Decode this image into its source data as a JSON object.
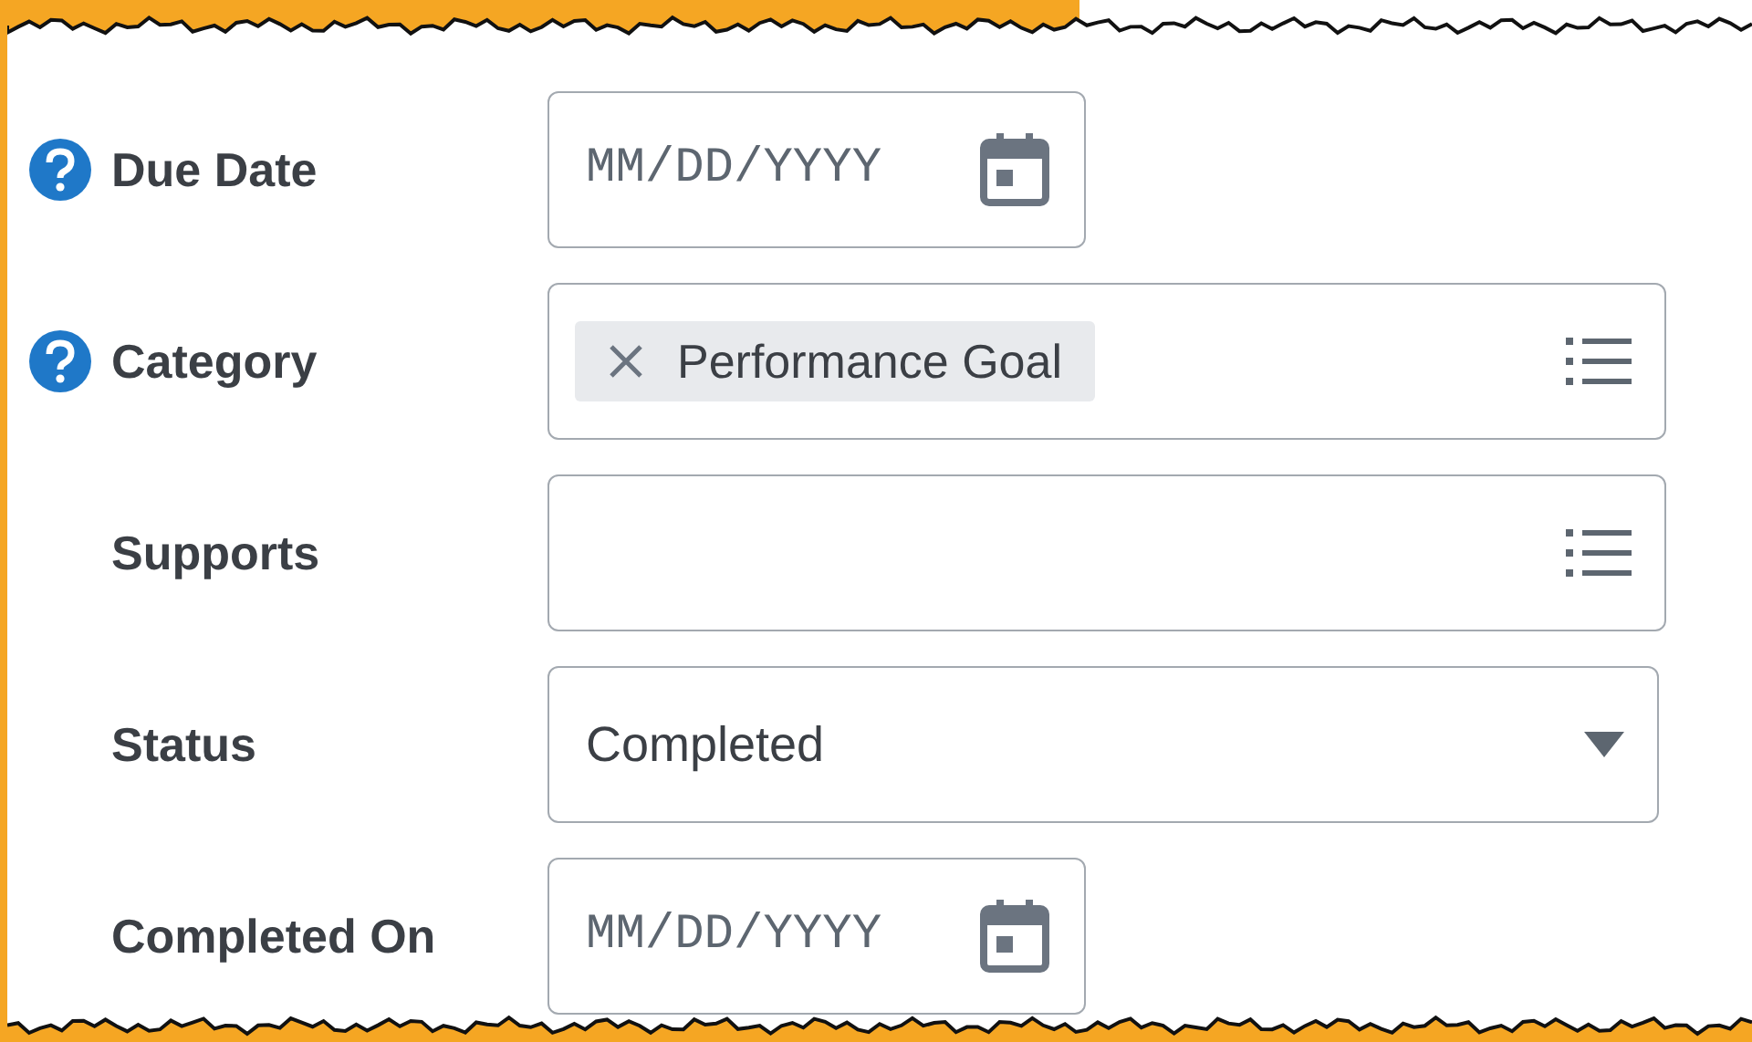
{
  "fields": [
    {
      "kind": "date",
      "label": "Due Date",
      "has_help": true,
      "placeholder": "MM/DD/YYYY"
    },
    {
      "kind": "multiselect",
      "label": "Category",
      "has_help": true,
      "tokens": [
        "Performance Goal"
      ]
    },
    {
      "kind": "multiselect",
      "label": "Supports",
      "has_help": false
    },
    {
      "kind": "select",
      "label": "Status",
      "has_help": false,
      "value": "Completed"
    },
    {
      "kind": "date",
      "label": "Completed On",
      "has_help": false,
      "placeholder": "MM/DD/YYYY"
    }
  ]
}
